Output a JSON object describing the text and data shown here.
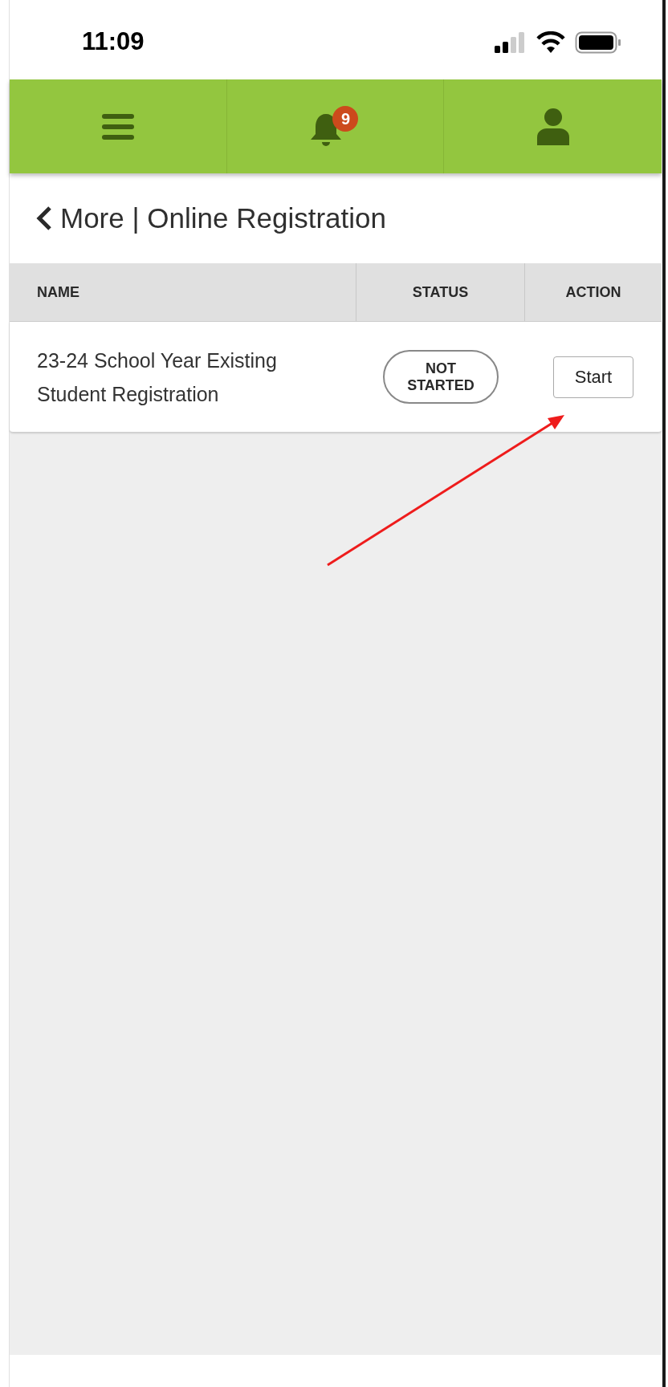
{
  "status_bar": {
    "time": "11:09"
  },
  "nav_bar": {
    "notification_count": "9"
  },
  "header": {
    "title": "More | Online Registration"
  },
  "table": {
    "columns": [
      "NAME",
      "STATUS",
      "ACTION"
    ],
    "rows": [
      {
        "name": "23-24 School Year Existing Student Registration",
        "status": "NOT STARTED",
        "action": "Start"
      }
    ]
  }
}
